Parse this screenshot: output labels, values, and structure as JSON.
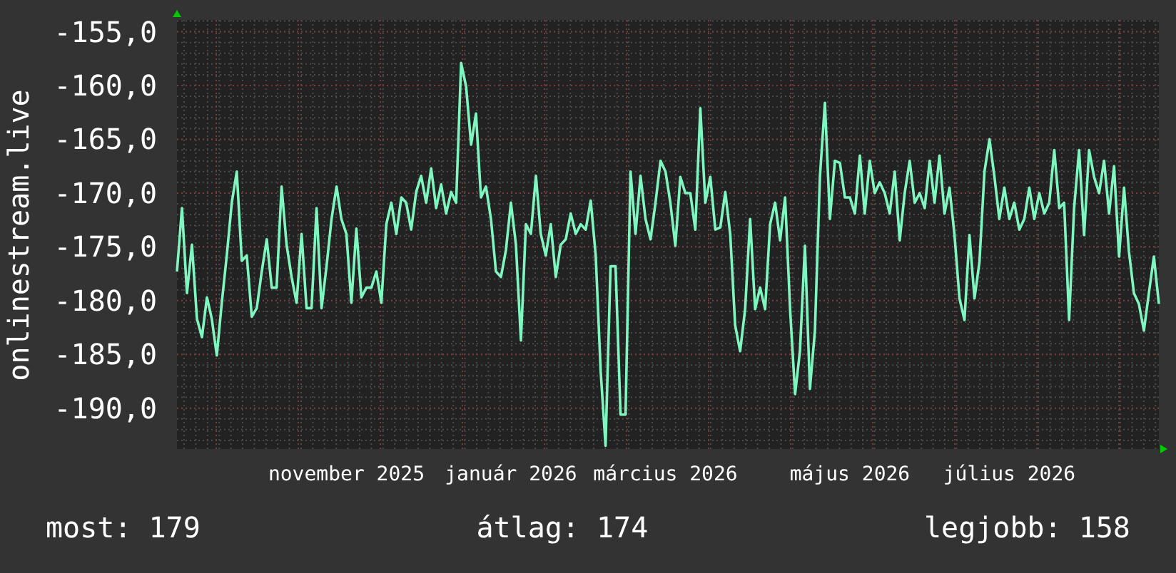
{
  "chart": {
    "chart_data": {
      "type": "line",
      "ylabel": "onlinestream.live",
      "grid": true,
      "ylim": [
        -193.8,
        -153.9
      ],
      "yticks": [
        {
          "value": -155,
          "label": "-155,0"
        },
        {
          "value": -160,
          "label": "-160,0"
        },
        {
          "value": -165,
          "label": "-165,0"
        },
        {
          "value": -170,
          "label": "-170,0"
        },
        {
          "value": -175,
          "label": "-175,0"
        },
        {
          "value": -180,
          "label": "-180,0"
        },
        {
          "value": -185,
          "label": "-185,0"
        },
        {
          "value": -190,
          "label": "-190,0"
        }
      ],
      "categories": [
        null,
        null,
        null,
        null,
        null,
        null,
        null,
        null,
        null,
        null,
        null,
        null,
        null,
        null,
        null,
        null,
        null,
        null,
        null,
        null,
        null,
        null,
        null,
        null,
        null,
        null,
        null,
        null,
        null,
        null,
        null,
        null,
        null,
        null,
        "november 2025",
        null,
        null,
        null,
        null,
        null,
        null,
        null,
        null,
        null,
        null,
        null,
        null,
        null,
        null,
        null,
        null,
        null,
        null,
        null,
        null,
        null,
        null,
        null,
        null,
        null,
        null,
        null,
        null,
        null,
        null,
        null,
        null,
        "január 2026",
        null,
        null,
        null,
        null,
        null,
        null,
        null,
        null,
        null,
        null,
        null,
        null,
        null,
        null,
        null,
        null,
        null,
        null,
        null,
        null,
        null,
        null,
        null,
        null,
        null,
        null,
        null,
        null,
        null,
        null,
        "március 2026",
        null,
        null,
        null,
        null,
        null,
        null,
        null,
        null,
        null,
        null,
        null,
        null,
        null,
        null,
        null,
        null,
        null,
        null,
        null,
        null,
        null,
        null,
        null,
        null,
        null,
        null,
        null,
        null,
        null,
        null,
        null,
        null,
        null,
        null,
        null,
        null,
        "május 2026",
        null,
        null,
        null,
        null,
        null,
        null,
        null,
        null,
        null,
        null,
        null,
        null,
        null,
        null,
        null,
        null,
        null,
        null,
        null,
        null,
        null,
        null,
        null,
        null,
        null,
        null,
        null,
        null,
        null,
        null,
        null,
        "július 2026",
        null,
        null,
        null,
        null,
        null,
        null,
        null,
        null,
        null,
        null,
        null,
        null,
        null,
        null,
        null,
        null,
        null,
        null,
        null,
        null,
        null,
        null,
        null,
        null,
        null,
        null,
        null,
        null,
        null,
        null
      ],
      "series": [
        {
          "color": "#7ff5c0",
          "values": [
            -177.3,
            -171.4,
            -179.3,
            -174.8,
            -181.7,
            -183.4,
            -179.7,
            -181.7,
            -185.1,
            -180.2,
            -175.8,
            -170.9,
            -168,
            -176.3,
            -175.8,
            -181.5,
            -180.7,
            -177.3,
            -174.3,
            -178.8,
            -178.8,
            -169.4,
            -174.8,
            -177.8,
            -180.2,
            -173.8,
            -180.7,
            -180.7,
            -171.4,
            -180.7,
            -176.8,
            -172.4,
            -169.4,
            -172.4,
            -173.8,
            -180.2,
            -173.3,
            -179.7,
            -178.8,
            -178.8,
            -177.3,
            -180.2,
            -172.9,
            -170.9,
            -173.8,
            -170.4,
            -170.9,
            -173.4,
            -169.9,
            -168.4,
            -170.9,
            -167.7,
            -171.4,
            -169.2,
            -171.9,
            -169.9,
            -170.9,
            -157.9,
            -160.1,
            -165.5,
            -162.6,
            -170.4,
            -169.4,
            -172.4,
            -177.3,
            -177.8,
            -175.3,
            -170.9,
            -174.8,
            -183.7,
            -172.9,
            -173.8,
            -168.4,
            -173.8,
            -175.8,
            -172.9,
            -177.8,
            -174.8,
            -174.3,
            -171.9,
            -173.8,
            -172.9,
            -173.4,
            -170.7,
            -175.8,
            -186.6,
            -193.5,
            -176.8,
            -176.8,
            -190.6,
            -190.6,
            -168,
            -173.8,
            -168.4,
            -172.4,
            -174.3,
            -170.9,
            -167,
            -168,
            -170.9,
            -174.9,
            -168.5,
            -170,
            -170,
            -173.4,
            -162.1,
            -170.9,
            -168.5,
            -173.4,
            -173.2,
            -169.9,
            -173.9,
            -182.3,
            -184.7,
            -180.8,
            -172.4,
            -180.8,
            -178.8,
            -180.8,
            -172.9,
            -170.9,
            -174.4,
            -170.4,
            -180.8,
            -188.7,
            -184.7,
            -174.9,
            -188.2,
            -182.8,
            -168.5,
            -161.6,
            -172.4,
            -167,
            -167.2,
            -170.4,
            -170.4,
            -171.9,
            -166.5,
            -171.9,
            -167,
            -170,
            -169,
            -170,
            -171.9,
            -168,
            -174.4,
            -170,
            -167,
            -170.9,
            -170,
            -171.4,
            -167,
            -170.9,
            -166.5,
            -171.9,
            -169.5,
            -173.9,
            -179.8,
            -181.8,
            -173.9,
            -179.8,
            -176.4,
            -168,
            -165,
            -168.5,
            -172.4,
            -169.5,
            -172.4,
            -170.9,
            -173.4,
            -172.4,
            -169.5,
            -172.4,
            -170,
            -171.9,
            -170.9,
            -166,
            -171.4,
            -170.9,
            -181.8,
            -171.4,
            -166,
            -173.9,
            -166,
            -168.5,
            -170,
            -167,
            -171.9,
            -167.5,
            -175.9,
            -169.5,
            -175.4,
            -179.3,
            -180.3,
            -182.8,
            -179.3,
            -175.9,
            -180.3
          ]
        }
      ]
    }
  },
  "stats": [
    "most: 179",
    "átlag: 174",
    "legjobb: 158"
  ]
}
